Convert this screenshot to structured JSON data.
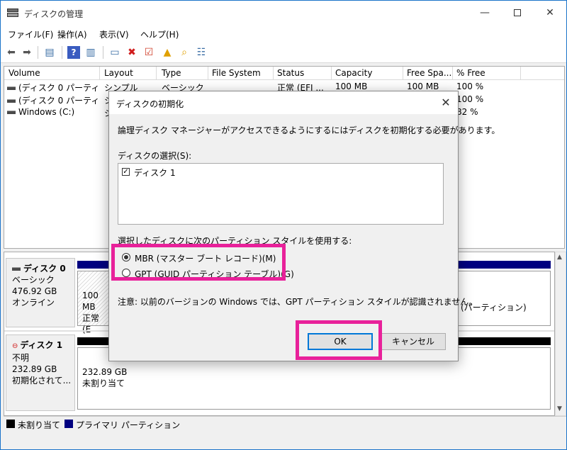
{
  "window": {
    "title": "ディスクの管理",
    "min": "—",
    "close": "✕"
  },
  "menu": [
    "ファイル(F)",
    "操作(A)",
    "表示(V)",
    "ヘルプ(H)"
  ],
  "columns": [
    "Volume",
    "Layout",
    "Type",
    "File System",
    "Status",
    "Capacity",
    "Free Spa...",
    "% Free"
  ],
  "volumes": [
    {
      "volume": "(ディスク 0 パーティシ...",
      "layout": "シンプル",
      "type": "ベーシック",
      "fs": "",
      "status": "正常 (EFI ...",
      "capacity": "100 MB",
      "free": "100 MB",
      "pct": "100 %"
    },
    {
      "volume": "(ディスク 0 パーティシ...",
      "layout": "シ",
      "type": "",
      "fs": "",
      "status": "",
      "capacity": "",
      "free": "",
      "pct": "100 %"
    },
    {
      "volume": "Windows (C:)",
      "layout": "シ",
      "type": "",
      "fs": "",
      "status": "",
      "capacity": "",
      "free": "",
      "pct": "82 %"
    }
  ],
  "disks": [
    {
      "name": "ディスク 0",
      "type": "ベーシック",
      "size": "476.92 GB",
      "state": "オンライン",
      "p1_size": "100 MB",
      "p1_status": "正常 (E",
      "p2_tail": "(パーティション)"
    },
    {
      "name": "ディスク 1",
      "type": "不明",
      "size": "232.89 GB",
      "state": "初期化されて...",
      "p1_size": "232.89 GB",
      "p1_status": "未割り当て"
    }
  ],
  "legend": {
    "unallocated": "未割り当て",
    "primary": "プライマリ パーティション"
  },
  "colors": {
    "accent": "#0078d7",
    "highlight": "#e8219a",
    "primary_partition": "#000080",
    "unallocated": "#000000"
  },
  "dialog": {
    "title": "ディスクの初期化",
    "close": "✕",
    "intro": "論理ディスク マネージャーがアクセスできるようにするにはディスクを初期化する必要があります。",
    "select_label": "ディスクの選択(S):",
    "disk_item": "ディスク 1",
    "style_label": "選択したディスクに次のパーティション スタイルを使用する:",
    "mbr": "MBR (マスター ブート レコード)(M)",
    "gpt": "GPT (GUID パーティション テーブル)(G)",
    "note": "注意: 以前のバージョンの Windows では、GPT パーティション スタイルが認識されません。",
    "ok": "OK",
    "cancel": "キャンセル"
  }
}
